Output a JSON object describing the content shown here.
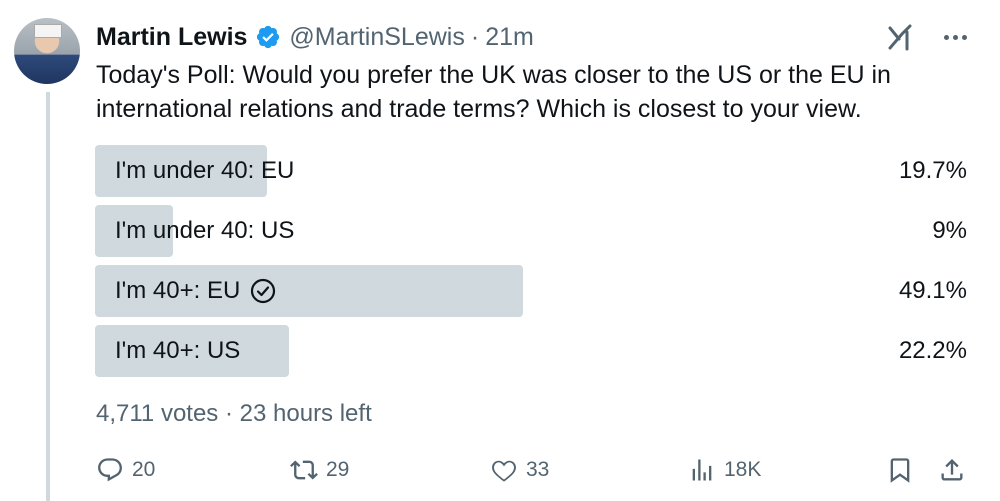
{
  "tweet": {
    "author_name": "Martin Lewis",
    "handle": "@MartinSLewis",
    "separator": "·",
    "time": "21m",
    "text": "Today's Poll: Would you prefer the UK was closer to the US or the EU in international relations and trade terms? Which is closest to your view.",
    "verified_color": "#1d9bf0"
  },
  "poll": {
    "options": [
      {
        "label": "I'm under 40: EU",
        "percent": "19.7%",
        "value": 19.7,
        "selected": false
      },
      {
        "label": "I'm under 40: US",
        "percent": "9%",
        "value": 9,
        "selected": false
      },
      {
        "label": "I'm 40+: EU",
        "percent": "49.1%",
        "value": 49.1,
        "selected": true
      },
      {
        "label": "I'm 40+: US",
        "percent": "22.2%",
        "value": 22.2,
        "selected": false
      }
    ],
    "votes": "4,711 votes",
    "separator": "·",
    "time_left": "23 hours left"
  },
  "actions": {
    "replies": "20",
    "reposts": "29",
    "likes": "33",
    "views": "18K"
  },
  "icons": {
    "verified": "verified-badge-icon",
    "grok": "grok-icon",
    "more": "more-icon",
    "check": "check-circle-icon",
    "reply": "reply-icon",
    "repost": "repost-icon",
    "like": "like-icon",
    "views": "views-icon",
    "bookmark": "bookmark-icon",
    "share": "share-icon"
  }
}
